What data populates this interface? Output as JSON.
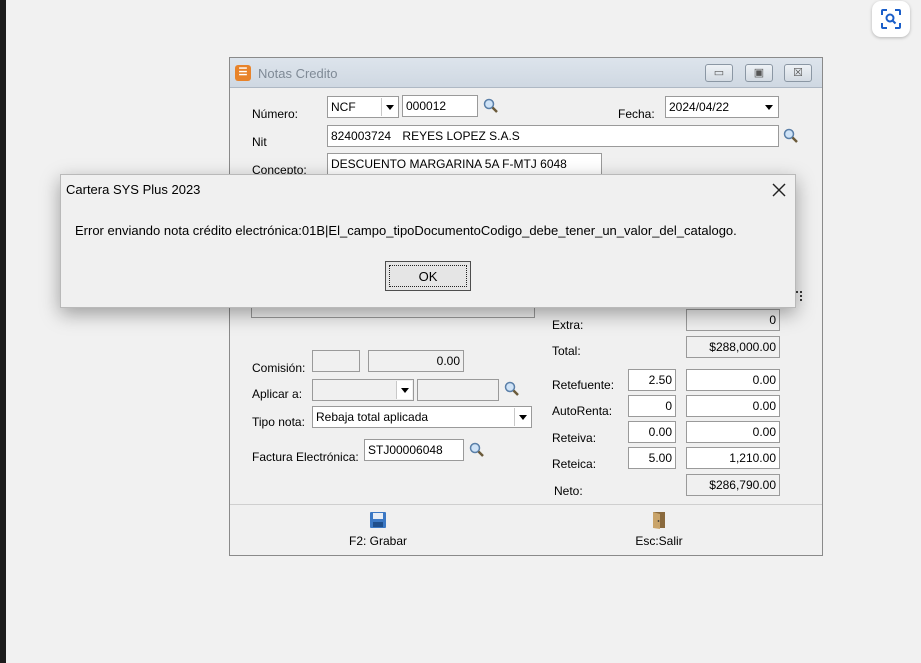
{
  "window": {
    "title": "Notas Credito",
    "minimize": "▭",
    "maximize": "▣",
    "close": "☒"
  },
  "form": {
    "numero_label": "Número:",
    "numero_type": "NCF",
    "numero_value": "000012",
    "fecha_label": "Fecha:",
    "fecha_value": "2024/04/22",
    "nit_label": "Nit",
    "nit_value": "824003724",
    "nit_name": "REYES LOPEZ S.A.S",
    "concepto_label": "Concepto:",
    "concepto_value": "DESCUENTO MARGARINA 5A F-MTJ 6048",
    "comision_label": "Comisión:",
    "comision_pct": "",
    "comision_value": "0.00",
    "aplicar_label": "Aplicar a:",
    "aplicar_value": "",
    "aplicar_extra": "",
    "tipo_nota_label": "Tipo nota:",
    "tipo_nota_value": "Rebaja total aplicada",
    "factura_label": "Factura Electrónica:",
    "factura_value": "STJ00006048",
    "extra_label": "Extra:",
    "extra_value": "0",
    "total_label": "Total:",
    "total_value": "$288,000.00",
    "retefuente_label": "Retefuente:",
    "retefuente_pct": "2.50",
    "retefuente_value": "0.00",
    "autorenta_label": "AutoRenta:",
    "autorenta_pct": "0",
    "autorenta_value": "0.00",
    "reteiva_label": "Reteiva:",
    "reteiva_pct": "0.00",
    "reteiva_value": "0.00",
    "reteica_label": "Reteica:",
    "reteica_pct": "5.00",
    "reteica_value": "1,210.00",
    "neto_label": "Neto:",
    "neto_value": "$286,790.00"
  },
  "toolbar": {
    "save_label": "F2: Grabar",
    "exit_label": "Esc:Salir"
  },
  "dialog": {
    "title": "Cartera SYS Plus 2023",
    "message": "Error enviando nota crédito electrónica:01B|El_campo_tipoDocumentoCodigo_debe_tener_un_valor_del_catalogo.",
    "ok_label": "OK"
  },
  "icons": {
    "lens": "image-search-icon",
    "magnifier": "magnifier-icon",
    "save": "floppy-disk-icon",
    "exit": "door-exit-icon"
  }
}
